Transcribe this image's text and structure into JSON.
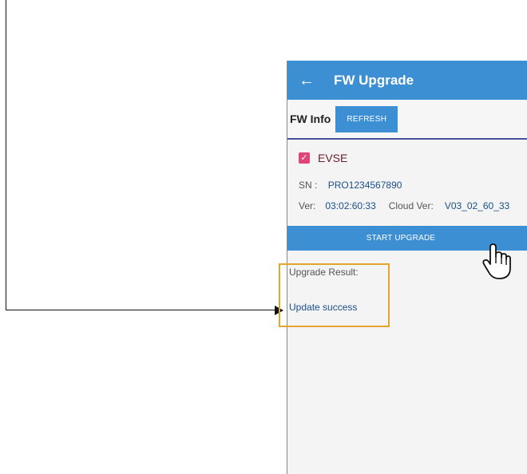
{
  "app_bar": {
    "back_icon": "arrow-left-icon",
    "back_glyph": "←",
    "title": "FW Upgrade"
  },
  "fw_info": {
    "label": "FW Info",
    "refresh_label": "REFRESH"
  },
  "device": {
    "checkbox_checked": true,
    "checkbox_glyph": "✓",
    "name": "EVSE",
    "sn_label": "SN :",
    "sn_value": "PRO1234567890",
    "ver_label": "Ver:",
    "ver_value": "03:02:60:33",
    "cloud_ver_label": "Cloud Ver:",
    "cloud_ver_value": "V03_02_60_33"
  },
  "upgrade_button_label": "START UPGRADE",
  "result": {
    "label": "Upgrade Result:",
    "value": "Update success"
  },
  "colors": {
    "accent": "#3d8fd4",
    "checkbox": "#e0457a",
    "highlight": "#e6a62e"
  },
  "icons": {
    "pointer": "hand-pointer-icon"
  }
}
